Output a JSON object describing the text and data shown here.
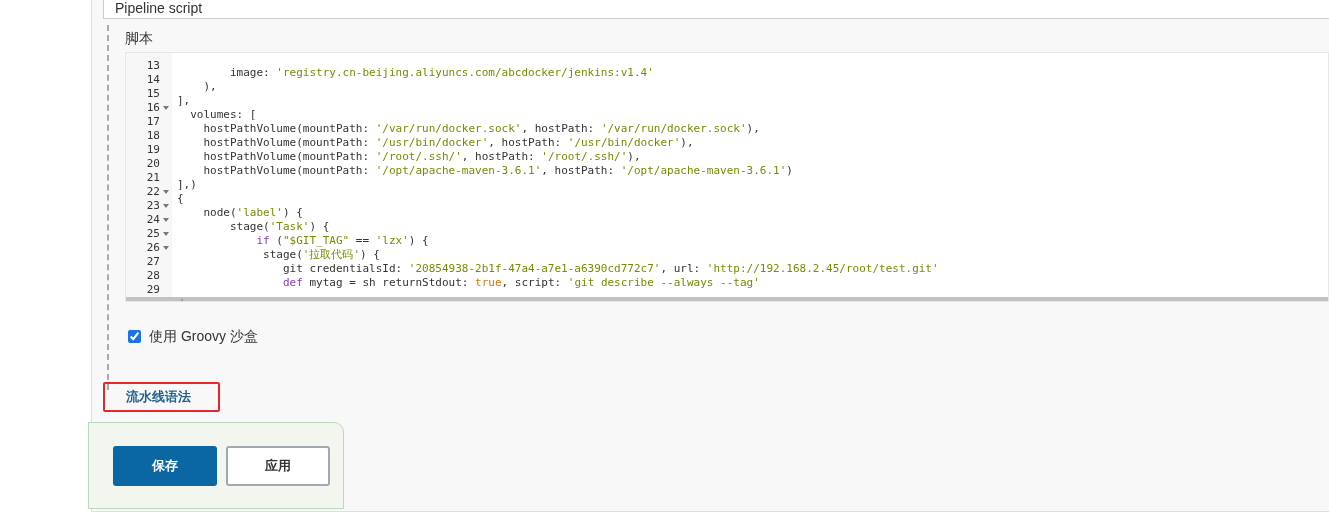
{
  "definition_field": {
    "value": "Pipeline script"
  },
  "script_label": "脚本",
  "editor": {
    "lines": [
      {
        "number": "13",
        "fold": false,
        "segments": [
          {
            "text": "        image: ",
            "kind": "plain"
          },
          {
            "text": "'registry.cn-beijing.aliyuncs.com/abcdocker/jenkins:v1.4'",
            "kind": "string"
          }
        ]
      },
      {
        "number": "14",
        "fold": false,
        "segments": [
          {
            "text": "    ),",
            "kind": "plain"
          }
        ]
      },
      {
        "number": "15",
        "fold": false,
        "segments": [
          {
            "text": "],",
            "kind": "plain"
          }
        ]
      },
      {
        "number": "16",
        "fold": true,
        "segments": [
          {
            "text": "  volumes: [",
            "kind": "plain"
          }
        ]
      },
      {
        "number": "17",
        "fold": false,
        "segments": [
          {
            "text": "    hostPathVolume(mountPath: ",
            "kind": "plain"
          },
          {
            "text": "'/var/run/docker.sock'",
            "kind": "string"
          },
          {
            "text": ", hostPath: ",
            "kind": "plain"
          },
          {
            "text": "'/var/run/docker.sock'",
            "kind": "string"
          },
          {
            "text": "),",
            "kind": "plain"
          }
        ]
      },
      {
        "number": "18",
        "fold": false,
        "segments": [
          {
            "text": "    hostPathVolume(mountPath: ",
            "kind": "plain"
          },
          {
            "text": "'/usr/bin/docker'",
            "kind": "string"
          },
          {
            "text": ", hostPath: ",
            "kind": "plain"
          },
          {
            "text": "'/usr/bin/docker'",
            "kind": "string"
          },
          {
            "text": "),",
            "kind": "plain"
          }
        ]
      },
      {
        "number": "19",
        "fold": false,
        "segments": [
          {
            "text": "    hostPathVolume(mountPath: ",
            "kind": "plain"
          },
          {
            "text": "'/root/.ssh/'",
            "kind": "string"
          },
          {
            "text": ", hostPath: ",
            "kind": "plain"
          },
          {
            "text": "'/root/.ssh/'",
            "kind": "string"
          },
          {
            "text": "),",
            "kind": "plain"
          }
        ]
      },
      {
        "number": "20",
        "fold": false,
        "segments": [
          {
            "text": "    hostPathVolume(mountPath: ",
            "kind": "plain"
          },
          {
            "text": "'/opt/apache-maven-3.6.1'",
            "kind": "string"
          },
          {
            "text": ", hostPath: ",
            "kind": "plain"
          },
          {
            "text": "'/opt/apache-maven-3.6.1'",
            "kind": "string"
          },
          {
            "text": ")",
            "kind": "plain"
          }
        ]
      },
      {
        "number": "21",
        "fold": false,
        "segments": [
          {
            "text": "],)",
            "kind": "plain"
          }
        ]
      },
      {
        "number": "22",
        "fold": true,
        "segments": [
          {
            "text": "{",
            "kind": "plain"
          }
        ]
      },
      {
        "number": "23",
        "fold": true,
        "segments": [
          {
            "text": "    node(",
            "kind": "plain"
          },
          {
            "text": "'label'",
            "kind": "string"
          },
          {
            "text": ") {",
            "kind": "plain"
          }
        ]
      },
      {
        "number": "24",
        "fold": true,
        "segments": [
          {
            "text": "        stage(",
            "kind": "plain"
          },
          {
            "text": "'Task'",
            "kind": "string"
          },
          {
            "text": ") {",
            "kind": "plain"
          }
        ]
      },
      {
        "number": "25",
        "fold": true,
        "segments": [
          {
            "text": "            if",
            "kind": "keyword"
          },
          {
            "text": " (",
            "kind": "plain"
          },
          {
            "text": "\"$GIT_TAG\"",
            "kind": "string"
          },
          {
            "text": " == ",
            "kind": "plain"
          },
          {
            "text": "'lzx'",
            "kind": "string"
          },
          {
            "text": ") {",
            "kind": "plain"
          }
        ]
      },
      {
        "number": "26",
        "fold": true,
        "segments": [
          {
            "text": "             stage(",
            "kind": "plain"
          },
          {
            "text": "'拉取代码'",
            "kind": "string"
          },
          {
            "text": ") {",
            "kind": "plain"
          }
        ]
      },
      {
        "number": "27",
        "fold": false,
        "segments": [
          {
            "text": "                git credentialsId: ",
            "kind": "plain"
          },
          {
            "text": "'20854938-2b1f-47a4-a7e1-a6390cd772c7'",
            "kind": "string"
          },
          {
            "text": ", url: ",
            "kind": "plain"
          },
          {
            "text": "'http://192.168.2.45/root/test.git'",
            "kind": "string"
          }
        ]
      },
      {
        "number": "28",
        "fold": false,
        "segments": [
          {
            "text": "                def",
            "kind": "keyword"
          },
          {
            "text": " mytag = sh returnStdout: ",
            "kind": "plain"
          },
          {
            "text": "true",
            "kind": "literal"
          },
          {
            "text": ", script: ",
            "kind": "plain"
          },
          {
            "text": "'git describe --always --tag'",
            "kind": "string"
          }
        ]
      },
      {
        "number": "29",
        "fold": false
      }
    ]
  },
  "sandbox_checkbox": {
    "label": "使用 Groovy 沙盒",
    "checked": true
  },
  "syntax_link": {
    "label": "流水线语法",
    "highlighted": true
  },
  "buttons": [
    {
      "label": "保存",
      "kind": "primary"
    },
    {
      "label": "应用",
      "kind": "secondary"
    }
  ]
}
